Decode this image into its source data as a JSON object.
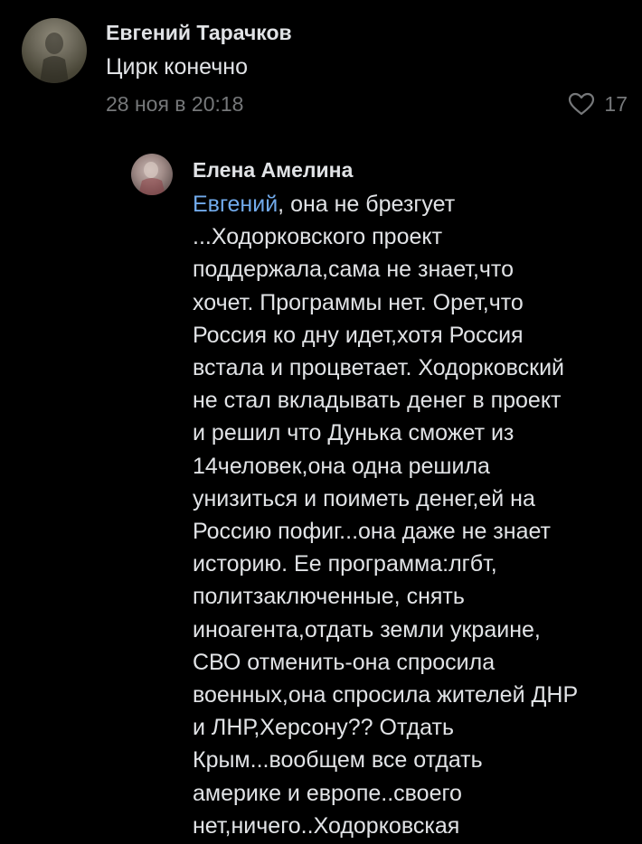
{
  "comments": [
    {
      "author": "Евгений Тарачков",
      "text": "Цирк конечно",
      "date": "28 ноя в 20:18",
      "likes": "17"
    },
    {
      "author": "Елена Амелина",
      "mention": "Евгений",
      "text": ", она не брезгует\n...Ходорковского проект\nподдержала,сама не знает,что\nхочет. Программы нет. Орет,что\nРоссия ко дну идет,хотя Россия\nвстала и процветает. Ходорковский\nне стал вкладывать денег в проект\nи решил что Дунька сможет из\n14человек,она одна решила\nунизиться и поиметь денег,ей на\nРоссию пофиг...она даже не знает\nисторию. Ее программа:лгбт,\nполитзаключенные, снять\nиноагента,отдать земли украине,\nСВО отменить-она спросила\nвоенных,она спросила жителей ДНР\nи ЛНР,Херсону?? Отдать\nКрым...вообщем все отдать\nамерике и европе..своего\nнет,ничего..Ходорковская"
    }
  ],
  "colors": {
    "background": "#000000",
    "text": "#e1e3e6",
    "secondary": "#76787a",
    "link": "#71aaeb"
  },
  "icons": {
    "like": "heart-outline-icon"
  }
}
